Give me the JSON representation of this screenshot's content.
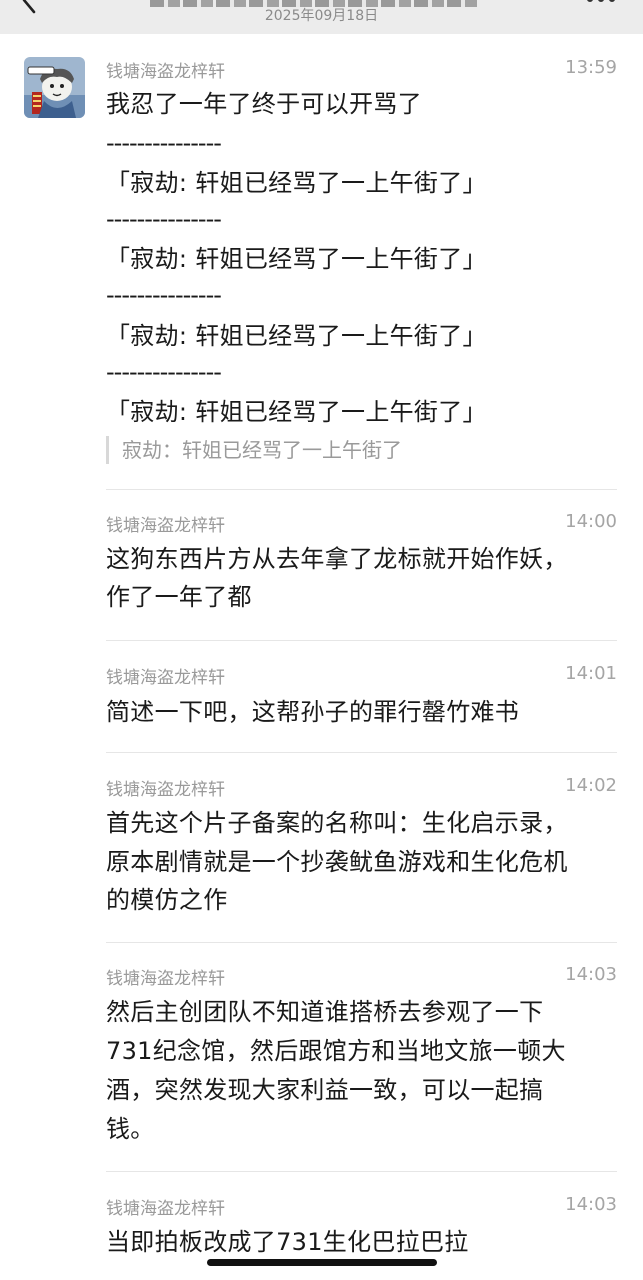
{
  "header": {
    "title_obscured": "",
    "date": "2025年09月18日"
  },
  "messages": [
    {
      "sender": "钱塘海盗龙梓轩",
      "time": "13:59",
      "lines": [
        "我忍了一年了终于可以开骂了",
        "---------------",
        "「寂劫: 轩姐已经骂了一上午街了」",
        "---------------",
        "「寂劫: 轩姐已经骂了一上午街了」",
        "---------------",
        "「寂劫: 轩姐已经骂了一上午街了」",
        "---------------",
        "「寂劫: 轩姐已经骂了一上午街了」"
      ],
      "quote": "寂劫：轩姐已经骂了一上午街了"
    },
    {
      "sender": "钱塘海盗龙梓轩",
      "time": "14:00",
      "lines": [
        "这狗东西片方从去年拿了龙标就开始作妖，",
        "作了一年了都"
      ]
    },
    {
      "sender": "钱塘海盗龙梓轩",
      "time": "14:01",
      "lines": [
        "简述一下吧，这帮孙子的罪行罄竹难书"
      ]
    },
    {
      "sender": "钱塘海盗龙梓轩",
      "time": "14:02",
      "lines": [
        "首先这个片子备案的名称叫：生化启示录，",
        "原本剧情就是一个抄袭鱿鱼游戏和生化危机",
        "的模仿之作"
      ]
    },
    {
      "sender": "钱塘海盗龙梓轩",
      "time": "14:03",
      "lines": [
        "然后主创团队不知道谁搭桥去参观了一下",
        "731纪念馆，然后跟馆方和当地文旅一顿大",
        "酒，突然发现大家利益一致，可以一起搞",
        "钱。"
      ]
    },
    {
      "sender": "钱塘海盗龙梓轩",
      "time": "14:03",
      "lines": [
        "当即拍板改成了731生化巴拉巴拉"
      ]
    }
  ],
  "icons": {
    "back": "chevron-left-icon",
    "more": "more-dots-icon",
    "avatar": "cartoon-avatar"
  }
}
